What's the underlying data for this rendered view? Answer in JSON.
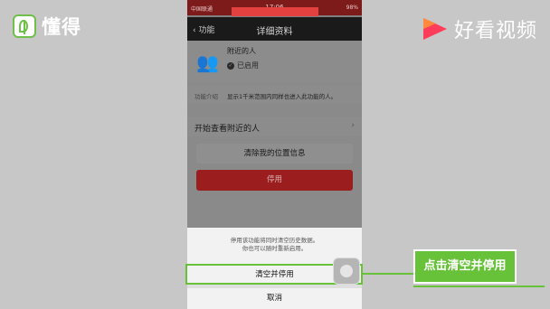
{
  "brand_left": {
    "name": "懂得"
  },
  "brand_right": {
    "name": "好看视频"
  },
  "statusbar": {
    "carrier": "中国联通",
    "time": "17:06",
    "battery": "98%"
  },
  "navbar": {
    "back_label": "功能",
    "title": "详细资料"
  },
  "feature": {
    "name": "附近的人",
    "status": "已启用",
    "intro_label": "功能介绍",
    "intro_text": "显示1千米范围内同样也进入此功能的人。"
  },
  "actions": {
    "start_label": "开始查看附近的人",
    "clear_location_label": "清除我的位置信息",
    "disable_label": "停用"
  },
  "sheet": {
    "message_line1": "停用该功能将同时清空历史数据。",
    "message_line2": "你也可以随时重新启用。",
    "confirm_label": "清空并停用",
    "cancel_label": "取消"
  },
  "callout": {
    "text": "点击清空并停用"
  },
  "colors": {
    "accent_green": "#67c23a",
    "danger_red": "#9b1d1d"
  }
}
